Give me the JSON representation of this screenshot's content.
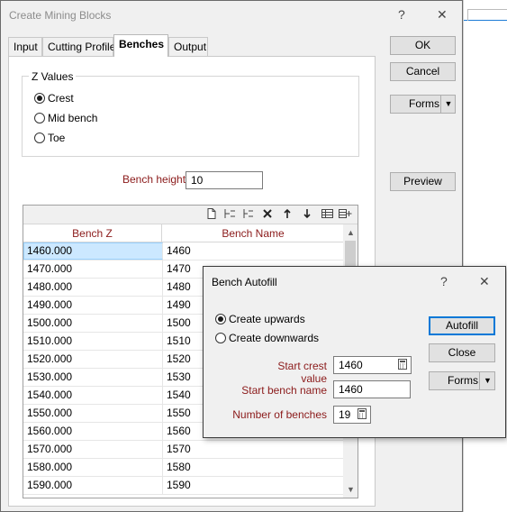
{
  "main": {
    "title": "Create Mining Blocks",
    "help_glyph": "?",
    "close_glyph": "✕",
    "tabs": [
      {
        "label": "Input"
      },
      {
        "label": "Cutting Profile"
      },
      {
        "label": "Benches"
      },
      {
        "label": "Output"
      }
    ],
    "buttons": {
      "ok": "OK",
      "cancel": "Cancel",
      "forms": "Forms",
      "preview": "Preview"
    },
    "z_values": {
      "legend": "Z Values",
      "options": [
        {
          "label": "Crest",
          "checked": true
        },
        {
          "label": "Mid bench",
          "checked": false
        },
        {
          "label": "Toe",
          "checked": false
        }
      ]
    },
    "bench_height": {
      "label": "Bench height",
      "value": "10"
    },
    "grid": {
      "columns": [
        "Bench Z",
        "Bench Name"
      ],
      "rows": [
        [
          "1460.000",
          "1460"
        ],
        [
          "1470.000",
          "1470"
        ],
        [
          "1480.000",
          "1480"
        ],
        [
          "1490.000",
          "1490"
        ],
        [
          "1500.000",
          "1500"
        ],
        [
          "1510.000",
          "1510"
        ],
        [
          "1520.000",
          "1520"
        ],
        [
          "1530.000",
          "1530"
        ],
        [
          "1540.000",
          "1540"
        ],
        [
          "1550.000",
          "1550"
        ],
        [
          "1560.000",
          "1560"
        ],
        [
          "1570.000",
          "1570"
        ],
        [
          "1580.000",
          "1580"
        ],
        [
          "1590.000",
          "1590"
        ]
      ]
    }
  },
  "autofill": {
    "title": "Bench Autofill",
    "help_glyph": "?",
    "close_glyph": "✕",
    "direction": [
      {
        "label": "Create upwards",
        "checked": true
      },
      {
        "label": "Create downwards",
        "checked": false
      }
    ],
    "start_crest": {
      "label": "Start crest value",
      "value": "1460"
    },
    "start_name": {
      "label": "Start bench name",
      "value": "1460"
    },
    "num_benches": {
      "label": "Number of benches",
      "value": "19"
    },
    "buttons": {
      "autofill": "Autofill",
      "close": "Close",
      "forms": "Forms"
    }
  },
  "colors": {
    "label_red": "#8b1a1a",
    "selection": "#cce8ff",
    "focus_border": "#0078d7"
  }
}
